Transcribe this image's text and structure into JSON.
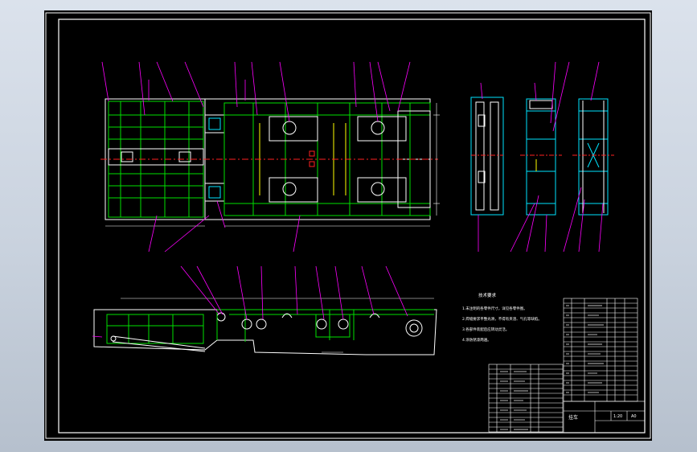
{
  "drawing": {
    "colors": {
      "background": "#000000",
      "frame": "#ffffff",
      "outline": "#ffffff",
      "structure": "#00e000",
      "leader": "#ff00ff",
      "centerline": "#ff2020",
      "part": "#00e5ff",
      "highlight": "#ffff00"
    },
    "tech_requirements": {
      "heading": "技术要求",
      "items": [
        "1.未注明的各零件尺寸，详见各零件图。",
        "2.焊缝要求平整光滑，不得有夹渣、气孔等缺陷。",
        "3.各部件装配后应转动灵活。",
        "4.涂防锈漆两遍。"
      ]
    },
    "title_block": {
      "drawing_name": "挂车",
      "scale": "1:20",
      "sheet_label": "A0"
    }
  }
}
